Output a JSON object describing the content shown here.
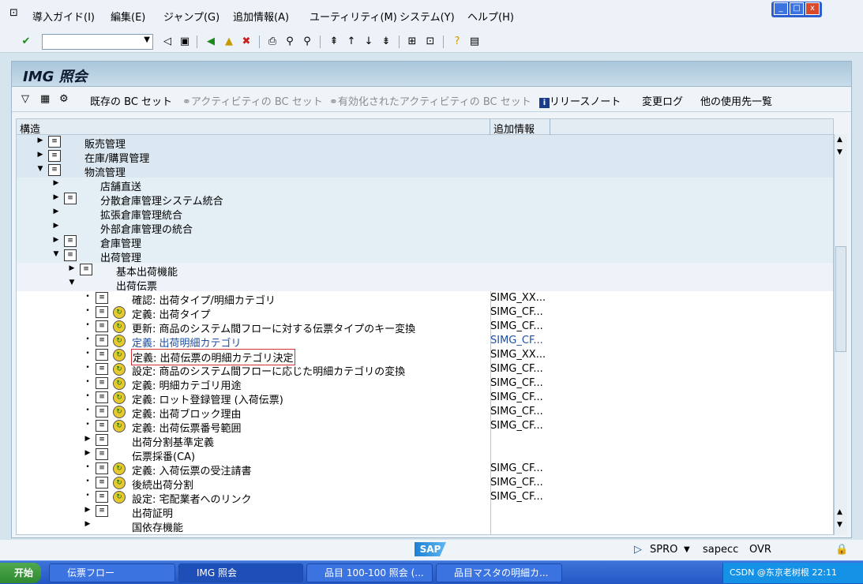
{
  "menu": {
    "items": [
      "導入ガイド(I)",
      "編集(E)",
      "ジャンプ(G)",
      "追加情報(A)",
      "ユーティリティ(M)",
      "システム(Y)",
      "ヘルプ(H)"
    ]
  },
  "window_buttons": {
    "min": "_",
    "restore": "□",
    "close": "x"
  },
  "command_field": {
    "value": ""
  },
  "title": "IMG 照会",
  "app_toolbar": {
    "existing_bc_set": "既存の BC セット",
    "activity_bc_set": "アクティビティの BC セット",
    "activated_activity_bc_set": "有効化されたアクティビティの BC セット",
    "release_notes": "リリースノート",
    "change_log": "変更ログ",
    "where_used": "他の使用先一覧"
  },
  "tree": {
    "header": {
      "structure": "構造",
      "additional_info": "追加情報"
    },
    "rows": [
      {
        "label": "販売管理",
        "add": ""
      },
      {
        "label": "在庫/購買管理",
        "add": ""
      },
      {
        "label": "物流管理",
        "add": ""
      },
      {
        "label": "店舗直送",
        "add": ""
      },
      {
        "label": "分散倉庫管理システム統合",
        "add": ""
      },
      {
        "label": "拡張倉庫管理統合",
        "add": ""
      },
      {
        "label": "外部倉庫管理の統合",
        "add": ""
      },
      {
        "label": "倉庫管理",
        "add": ""
      },
      {
        "label": "出荷管理",
        "add": ""
      },
      {
        "label": "基本出荷機能",
        "add": ""
      },
      {
        "label": "出荷伝票",
        "add": ""
      },
      {
        "label": "確認: 出荷タイプ/明細カテゴリ",
        "add": "SIMG_XX..."
      },
      {
        "label": "定義: 出荷タイプ",
        "add": "SIMG_CF..."
      },
      {
        "label": "更新: 商品のシステム間フローに対する伝票タイプのキー変換",
        "add": "SIMG_CF..."
      },
      {
        "label": "定義: 出荷明細カテゴリ",
        "add": "SIMG_CF..."
      },
      {
        "label": "定義: 出荷伝票の明細カテゴリ決定",
        "add": "SIMG_XX..."
      },
      {
        "label": "設定: 商品のシステム間フローに応じた明細カテゴリの変換",
        "add": "SIMG_CF..."
      },
      {
        "label": "定義: 明細カテゴリ用途",
        "add": "SIMG_CF..."
      },
      {
        "label": "定義: ロット登録管理 (入荷伝票)",
        "add": "SIMG_CF..."
      },
      {
        "label": "定義: 出荷ブロック理由",
        "add": "SIMG_CF..."
      },
      {
        "label": "定義: 出荷伝票番号範囲",
        "add": "SIMG_CF..."
      },
      {
        "label": "出荷分割基準定義",
        "add": ""
      },
      {
        "label": "伝票採番(CA)",
        "add": ""
      },
      {
        "label": "定義: 入荷伝票の受注請書",
        "add": "SIMG_CF..."
      },
      {
        "label": "後続出荷分割",
        "add": "SIMG_CF..."
      },
      {
        "label": "設定: 宅配業者へのリンク",
        "add": "SIMG_CF..."
      },
      {
        "label": "出荷証明",
        "add": ""
      },
      {
        "label": "国依存機能",
        "add": ""
      }
    ]
  },
  "status_bar": {
    "tcode": "SPRO",
    "server": "sapecc",
    "mode": "OVR"
  },
  "taskbar": {
    "start": "开始",
    "tasks": [
      "伝票フロー",
      "IMG 照会",
      "品目 100-100 照会 (...",
      "品目マスタの明細カ..."
    ],
    "tray_text": "CSDN @东京老树根 22:11"
  },
  "colors": {
    "accent": "#1f4fa0",
    "highlight_border": "#d83030",
    "title_bg": "#b9d2e4"
  }
}
